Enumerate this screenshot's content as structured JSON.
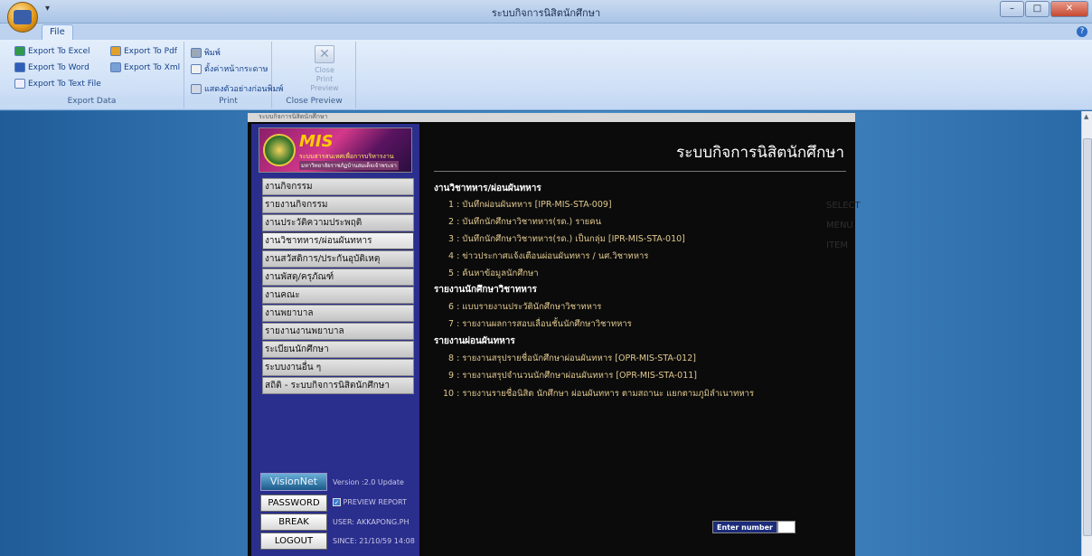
{
  "window": {
    "title": "ระบบกิจการนิสิตนักศึกษา",
    "quick_access": "▾",
    "minimize": "–",
    "maximize": "□",
    "close": "✕"
  },
  "ribbon": {
    "file_tab": "File",
    "help": "?",
    "export_group": {
      "label": "Export Data",
      "excel": "Export To Excel",
      "word": "Export To Word",
      "text": "Export To Text File",
      "pdf": "Export To Pdf",
      "xml": "Export To Xml"
    },
    "print_group": {
      "label": "Print",
      "print": "พิมพ์",
      "page_setup": "ตั้งค่าหน้ากระดาษ",
      "preview": "แสดงตัวอย่างก่อนพิมพ์"
    },
    "close_group": {
      "label": "Close Preview",
      "close_button": "Close Print Preview"
    }
  },
  "page": {
    "header_caption": "ระบบกิจการนิสิตนักศึกษา",
    "logo": {
      "mis": "MIS",
      "line1": "ระบบสารสนเทศเพื่อการบริหารงาน",
      "line2": "มหาวิทยาลัยราชภัฏบ้านสมเด็จเจ้าพระยา"
    },
    "menu": [
      "งานกิจกรรม",
      "รายงานกิจกรรม",
      "งานประวัติความประพฤติ",
      "งานวิชาทหาร/ผ่อนผันทหาร",
      "งานสวัสดิการ/ประกันอุบัติเหตุ",
      "งานพัสดุ/ครุภัณฑ์",
      "งานคณะ",
      "งานพยาบาล",
      "รายงานงานพยาบาล",
      "ระเบียนนักศึกษา",
      "ระบบงานอื่น ๆ",
      "สถิติ - ระบบกิจการนิสิตนักศึกษา"
    ],
    "visionnet": "VisionNet",
    "version": "Version :2.0 Update",
    "buttons": {
      "password": "PASSWORD",
      "break": "BREAK",
      "logout": "LOGOUT"
    },
    "preview_report": "PREVIEW REPORT",
    "user": "USER: AKKAPONG.PH",
    "since": "SINCE: 21/10/59 14:08",
    "content": {
      "title": "ระบบกิจการนิสิตนักศึกษา",
      "watermark": "SELECT MENU ITEM",
      "sections": [
        {
          "title": "งานวิชาทหาร/ผ่อนผันทหาร",
          "items": [
            "1 : บันทึกผ่อนผันทหาร [IPR-MIS-STA-009]",
            "2 : บันทึกนักศึกษาวิชาทหาร(รด.) รายคน",
            "3 : บันทึกนักศึกษาวิชาทหาร(รด.) เป็นกลุ่ม [IPR-MIS-STA-010]",
            "4 : ข่าวประกาศแจ้งเตือนผ่อนผันทหาร / นศ.วิชาทหาร",
            "5 : ค้นหาข้อมูลนักศึกษา"
          ]
        },
        {
          "title": "รายงานนักศึกษาวิชาทหาร",
          "items": [
            "6 : แบบรายงานประวัตินักศึกษาวิชาทหาร",
            "7 : รายงานผลการสอบเลื่อนชั้นนักศึกษาวิชาทหาร"
          ]
        },
        {
          "title": "รายงานผ่อนผันทหาร",
          "items": [
            "8 : รายงานสรุปรายชื่อนักศึกษาผ่อนผันทหาร [OPR-MIS-STA-012]",
            "9 : รายงานสรุปจำนวนนักศึกษาผ่อนผันทหาร [OPR-MIS-STA-011]",
            "10 : รายงานรายชื่อนิสิต นักศึกษา ผ่อนผันทหาร ตามสถานะ แยกตามภูมิลำเนาทหาร"
          ]
        }
      ],
      "enter_number": "Enter number"
    }
  }
}
